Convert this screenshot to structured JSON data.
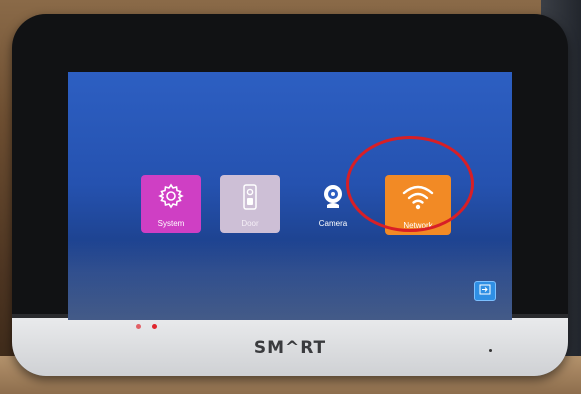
{
  "screen": {
    "tiles": [
      {
        "label": "System",
        "icon": "gear-icon",
        "color": "#cf3fc4"
      },
      {
        "label": "Door",
        "icon": "doorbell-icon",
        "color": "#cdbfd6"
      },
      {
        "label": "Camera",
        "icon": "webcam-icon",
        "color": "#2d5fc2"
      },
      {
        "label": "Network",
        "icon": "wifi-icon",
        "color": "#f28a25"
      }
    ],
    "exit_button": {
      "icon": "exit-icon"
    },
    "highlighted_tile": "Network",
    "highlight_color": "#d81f26"
  },
  "device": {
    "brand": "SM^RT"
  }
}
